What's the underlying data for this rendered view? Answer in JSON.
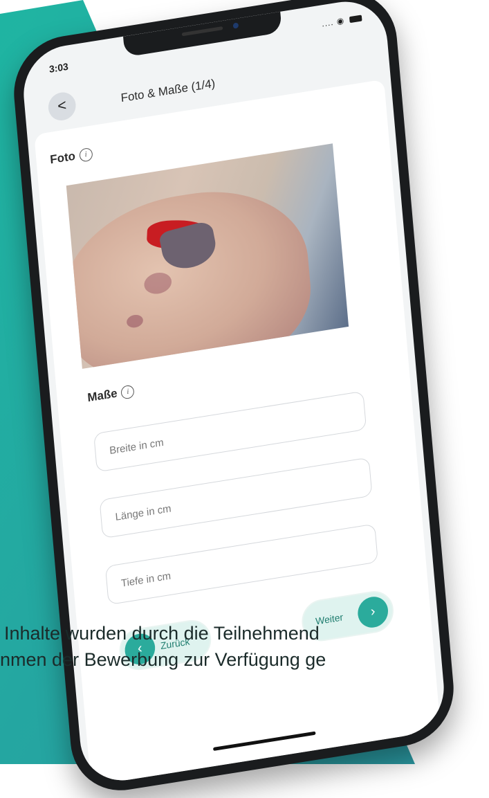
{
  "status_bar": {
    "time": "3:03",
    "signal": "...."
  },
  "nav": {
    "back_glyph": "<",
    "title": "Foto & Maße (1/4)"
  },
  "sections": {
    "photo": {
      "label": "Foto",
      "info": "i"
    },
    "measurements": {
      "label": "Maße",
      "info": "i"
    }
  },
  "fields": {
    "width": {
      "placeholder": "Breite in cm"
    },
    "length": {
      "placeholder": "Länge in cm"
    },
    "depth": {
      "placeholder": "Tiefe in cm"
    }
  },
  "buttons": {
    "back": {
      "label": "Zurück",
      "icon": "chevron-left-icon"
    },
    "next": {
      "label": "Weiter",
      "icon": "chevron-right-icon"
    }
  },
  "caption": {
    "line1": "Inhalte wurden durch die Teilnehmend",
    "line2": "nmen der Bewerbung zur Verfügung ge"
  },
  "colors": {
    "accent": "#2bab9c",
    "background_teal": "#2aa79c"
  }
}
